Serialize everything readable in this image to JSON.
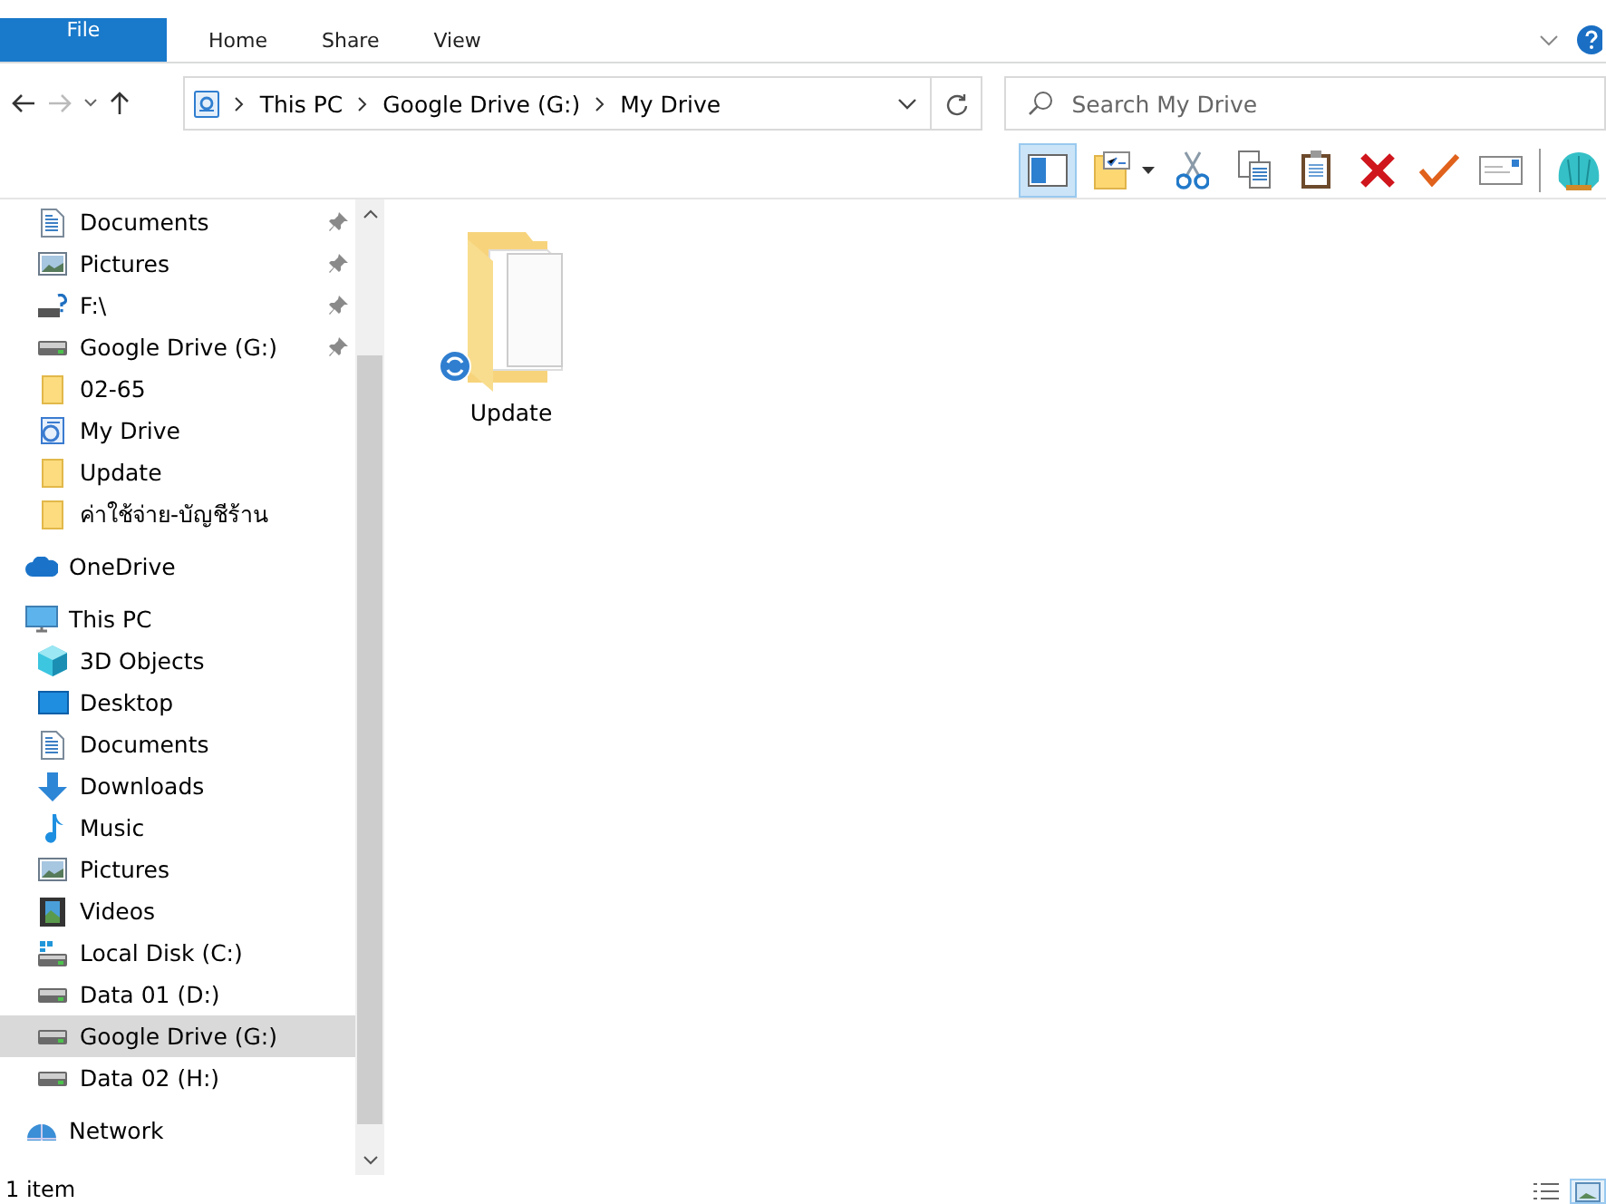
{
  "ribbon": {
    "tabs": [
      {
        "label": "File",
        "kind": "file",
        "selected": false
      },
      {
        "label": "Home",
        "kind": "tab",
        "selected": false
      },
      {
        "label": "Share",
        "kind": "tab",
        "selected": false
      },
      {
        "label": "View",
        "kind": "tab",
        "selected": false
      }
    ]
  },
  "address_bar": {
    "path": [
      "This PC",
      "Google Drive (G:)",
      "My Drive"
    ]
  },
  "search": {
    "placeholder": "Search My Drive"
  },
  "toolbar": {
    "preview_pane": {
      "selected": true
    },
    "buttons": [
      {
        "kind": "properties"
      },
      {
        "kind": "cut"
      },
      {
        "kind": "copy"
      },
      {
        "kind": "paste"
      },
      {
        "kind": "delete"
      },
      {
        "kind": "check"
      },
      {
        "kind": "mail"
      },
      {
        "kind": "shell"
      }
    ]
  },
  "navigation": {
    "quick_access_items": [
      {
        "label": "Documents",
        "kind": "document",
        "pinned": true,
        "selected": false
      },
      {
        "label": "Pictures",
        "kind": "picture",
        "pinned": true,
        "selected": false
      },
      {
        "label": "F:\\",
        "kind": "unknown-drive",
        "pinned": true,
        "selected": false
      },
      {
        "label": "Google Drive (G:)",
        "kind": "drive",
        "pinned": true,
        "selected": false
      },
      {
        "label": "02-65",
        "kind": "folder",
        "pinned": false,
        "selected": false
      },
      {
        "label": "My Drive",
        "kind": "sync-folder",
        "pinned": false,
        "selected": false
      },
      {
        "label": "Update",
        "kind": "folder",
        "pinned": false,
        "selected": false
      },
      {
        "label": "ค่าใช้จ่าย-บัญชีร้าน",
        "kind": "folder",
        "pinned": false,
        "selected": false
      }
    ],
    "tree": [
      {
        "label": "OneDrive",
        "kind": "cloud",
        "selected": false
      },
      {
        "label": "This PC",
        "kind": "computer",
        "selected": false,
        "children": [
          {
            "label": "3D Objects",
            "kind": "cube",
            "selected": false
          },
          {
            "label": "Desktop",
            "kind": "desktop",
            "selected": false
          },
          {
            "label": "Documents",
            "kind": "document",
            "selected": false
          },
          {
            "label": "Downloads",
            "kind": "download",
            "selected": false
          },
          {
            "label": "Music",
            "kind": "music",
            "selected": false
          },
          {
            "label": "Pictures",
            "kind": "picture",
            "selected": false
          },
          {
            "label": "Videos",
            "kind": "video",
            "selected": false
          },
          {
            "label": "Local Disk (C:)",
            "kind": "system-drive",
            "selected": false
          },
          {
            "label": "Data 01 (D:)",
            "kind": "drive",
            "selected": false
          },
          {
            "label": "Google Drive (G:)",
            "kind": "drive",
            "selected": true
          },
          {
            "label": "Data 02 (H:)",
            "kind": "drive",
            "selected": false
          }
        ]
      },
      {
        "label": "Network",
        "kind": "network",
        "selected": false
      }
    ]
  },
  "files": [
    {
      "name": "Update",
      "kind": "folder",
      "syncing": true
    }
  ],
  "status_bar": {
    "text": "1 item"
  }
}
